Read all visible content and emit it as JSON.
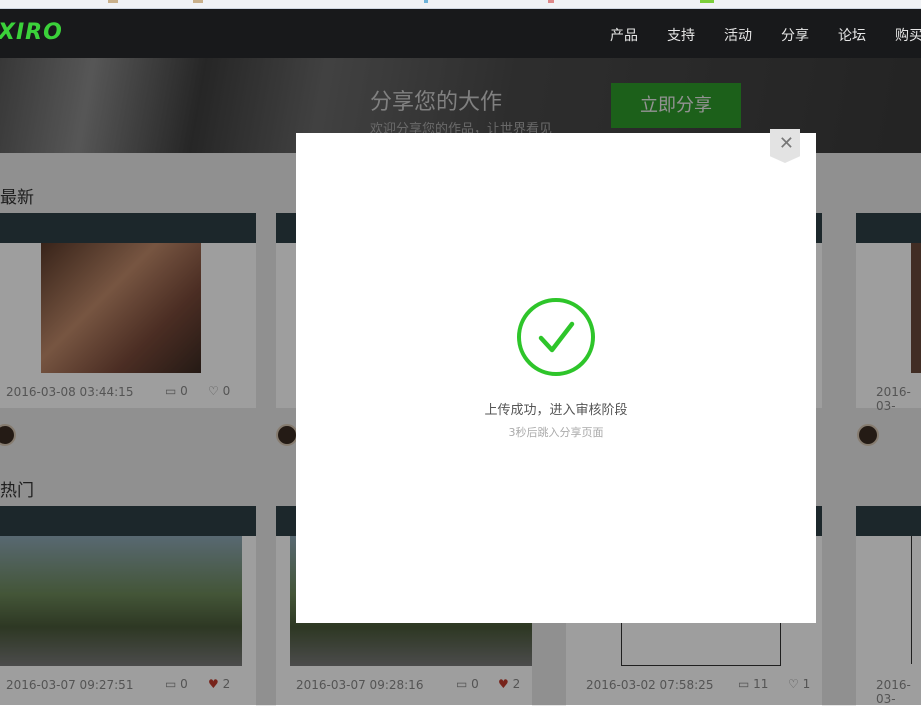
{
  "header": {
    "logo": "XIRO",
    "nav": [
      "产品",
      "支持",
      "活动",
      "分享",
      "论坛",
      "购买"
    ]
  },
  "banner": {
    "title": "分享您的大作",
    "subtitle": "欢迎分享您的作品，让世界看见",
    "button": "立即分享"
  },
  "sections": {
    "latest": "最新",
    "hot": "热门"
  },
  "latest_cards": [
    {
      "date": "2016-03-08 03:44:15",
      "comments": "0",
      "likes": "0"
    },
    {
      "date": "2016-03-",
      "comments": "",
      "likes": ""
    }
  ],
  "hot_cards": [
    {
      "date": "2016-03-07 09:27:51",
      "comments": "0",
      "likes": "2"
    },
    {
      "date": "2016-03-07 09:28:16",
      "comments": "0",
      "likes": "2"
    },
    {
      "date": "2016-03-02 07:58:25",
      "comments": "11",
      "likes": "1"
    },
    {
      "date": "2016-03-",
      "comments": "",
      "likes": ""
    }
  ],
  "modal": {
    "message": "上传成功，进入审核阶段",
    "submessage": "3秒后跳入分享页面",
    "close_icon": "close-icon",
    "status_icon": "check-circle-icon",
    "accent": "#2ec52a"
  }
}
